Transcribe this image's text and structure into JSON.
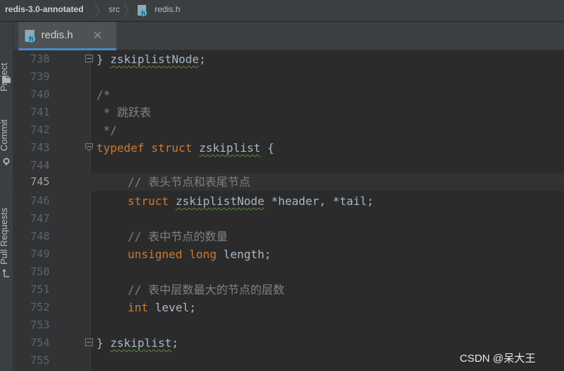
{
  "breadcrumb": {
    "project": "redis-3.0-annotated",
    "folder": "src",
    "file": "redis.h"
  },
  "toolwindows": {
    "project": "Project",
    "commit": "Commit",
    "pull_requests": "Pull Requests"
  },
  "tab": {
    "label": "redis.h",
    "close": "×"
  },
  "editor": {
    "current_line": "745",
    "lines": [
      {
        "n": "738"
      },
      {
        "n": "739"
      },
      {
        "n": "740"
      },
      {
        "n": "741"
      },
      {
        "n": "742"
      },
      {
        "n": "743"
      },
      {
        "n": "744"
      },
      {
        "n": "745"
      },
      {
        "n": "746"
      },
      {
        "n": "747"
      },
      {
        "n": "748"
      },
      {
        "n": "749"
      },
      {
        "n": "750"
      },
      {
        "n": "751"
      },
      {
        "n": "752"
      },
      {
        "n": "753"
      },
      {
        "n": "754"
      },
      {
        "n": "755"
      }
    ],
    "code": {
      "l738_brace": "} ",
      "l738_name": "zskiplistNode",
      "l738_semi": ";",
      "l740": "/*",
      "l741": " * 跳跃表",
      "l742": " */",
      "l743_kw1": "typedef",
      "l743_kw2": "struct",
      "l743_name": "zskiplist",
      "l743_brace": "{",
      "l745_comment": "// 表头节点和表尾节点",
      "l746_kw": "struct",
      "l746_type": "zskiplistNode",
      "l746_rest": " *header, *tail;",
      "l748_comment": "// 表中节点的数量",
      "l749_kw1": "unsigned",
      "l749_kw2": "long",
      "l749_rest": " length;",
      "l751_comment": "// 表中层数最大的节点的层数",
      "l752_kw": "int",
      "l752_rest": " level;",
      "l754_brace": "} ",
      "l754_name": "zskiplist",
      "l754_semi": ";"
    }
  },
  "watermark": "CSDN @呆大王",
  "colors": {
    "keyword": "#cc7832",
    "comment": "#808080",
    "text": "#a9b7c6",
    "background": "#2b2b2b"
  }
}
